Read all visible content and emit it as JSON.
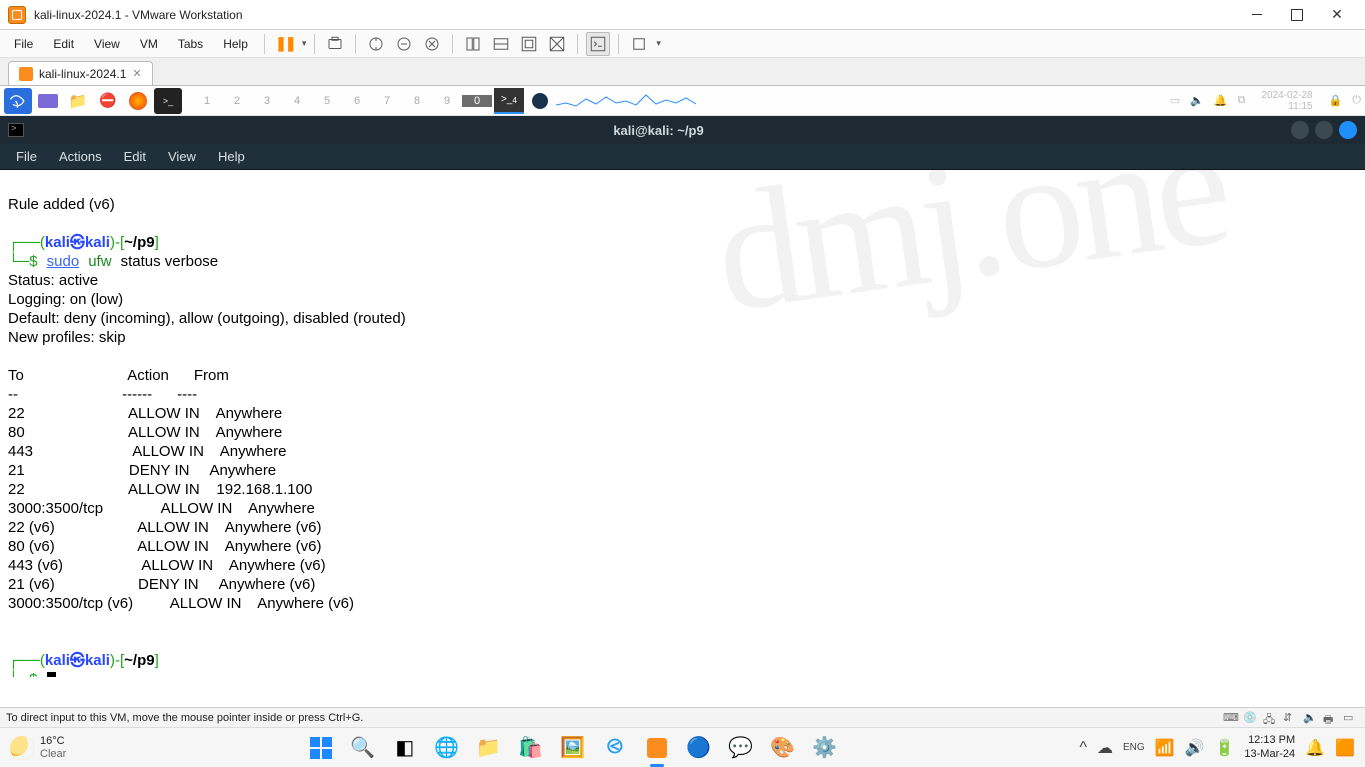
{
  "vmware": {
    "title": "kali-linux-2024.1 - VMware Workstation",
    "menu": {
      "file": "File",
      "edit": "Edit",
      "view": "View",
      "vm": "VM",
      "tabs": "Tabs",
      "help": "Help"
    },
    "tab_label": "kali-linux-2024.1",
    "status_hint": "To direct input to this VM, move the mouse pointer inside or press Ctrl+G."
  },
  "kali_panel": {
    "workspaces": [
      "1",
      "2",
      "3",
      "4",
      "5",
      "6",
      "7",
      "8",
      "9",
      "0"
    ],
    "active_ws_index": 9,
    "term_badge": "4",
    "clock": {
      "date": "2024-02-28",
      "time": "11:15"
    }
  },
  "terminal": {
    "title": "kali@kali: ~/p9",
    "menu": {
      "file": "File",
      "actions": "Actions",
      "edit": "Edit",
      "view": "View",
      "help": "Help"
    },
    "watermark": "dmj.one",
    "line_rule_added": "Rule added (v6)",
    "prompt": {
      "user": "kali",
      "host": "kali",
      "path": "~/p9",
      "open": "┌──(",
      "sep": "㉿",
      "close": ")-[",
      "end": "]",
      "line2": "└─$"
    },
    "command": {
      "sudo": "sudo",
      "ufw": "ufw",
      "rest": "status verbose"
    },
    "output_lines": [
      "Status: active",
      "Logging: on (low)",
      "Default: deny (incoming), allow (outgoing), disabled (routed)",
      "New profiles: skip"
    ],
    "table_header": "To                         Action      From",
    "table_sep": "--                         ------      ----",
    "rules": [
      {
        "to": "22",
        "action": "ALLOW IN",
        "from": "Anywhere"
      },
      {
        "to": "80",
        "action": "ALLOW IN",
        "from": "Anywhere"
      },
      {
        "to": "443",
        "action": "ALLOW IN",
        "from": "Anywhere"
      },
      {
        "to": "21",
        "action": "DENY IN",
        "from": "Anywhere"
      },
      {
        "to": "22",
        "action": "ALLOW IN",
        "from": "192.168.1.100"
      },
      {
        "to": "3000:3500/tcp",
        "action": "ALLOW IN",
        "from": "Anywhere"
      },
      {
        "to": "22 (v6)",
        "action": "ALLOW IN",
        "from": "Anywhere (v6)"
      },
      {
        "to": "80 (v6)",
        "action": "ALLOW IN",
        "from": "Anywhere (v6)"
      },
      {
        "to": "443 (v6)",
        "action": "ALLOW IN",
        "from": "Anywhere (v6)"
      },
      {
        "to": "21 (v6)",
        "action": "DENY IN",
        "from": "Anywhere (v6)"
      },
      {
        "to": "3000:3500/tcp (v6)",
        "action": "ALLOW IN",
        "from": "Anywhere (v6)"
      }
    ]
  },
  "windows": {
    "weather": {
      "temp": "16°C",
      "cond": "Clear"
    },
    "tray": {
      "time": "12:13 PM",
      "date": "13-Mar-24"
    }
  }
}
